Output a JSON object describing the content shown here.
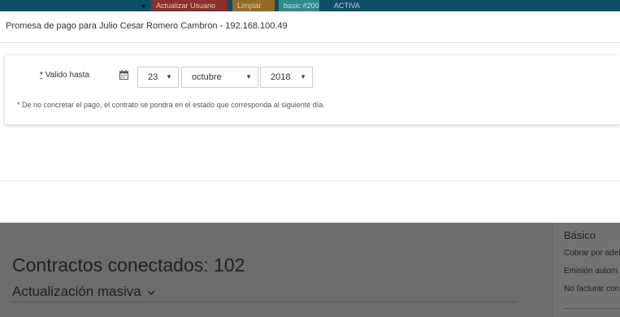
{
  "background": {
    "top_bar": {
      "btn_update_user": "Actualizar Usuario",
      "btn_clean": "Limpiar",
      "badge_plan": "basic #200",
      "status": "ACTIVA"
    },
    "page_title": "Contractos conectados: 102",
    "bulk_update_label": "Actualización masiva",
    "side_panel": {
      "heading": "Básico",
      "rows": [
        "Cobrar por adel",
        "Emisión autom",
        "No facturar con"
      ]
    }
  },
  "modal": {
    "title": "Promesa de pago para Julio Cesar Romero Cambron - 192.168.100.49",
    "field_label_prefix": "*",
    "field_label": "Valido hasta",
    "day": "23",
    "month": "octubre",
    "year": "2018",
    "note": "* De no concretar el pago, el contrato se pondrá en el estado que corresponda al siguiente día."
  },
  "icons": {
    "calendar": "calendar-icon",
    "caret": "caret-down-icon"
  }
}
